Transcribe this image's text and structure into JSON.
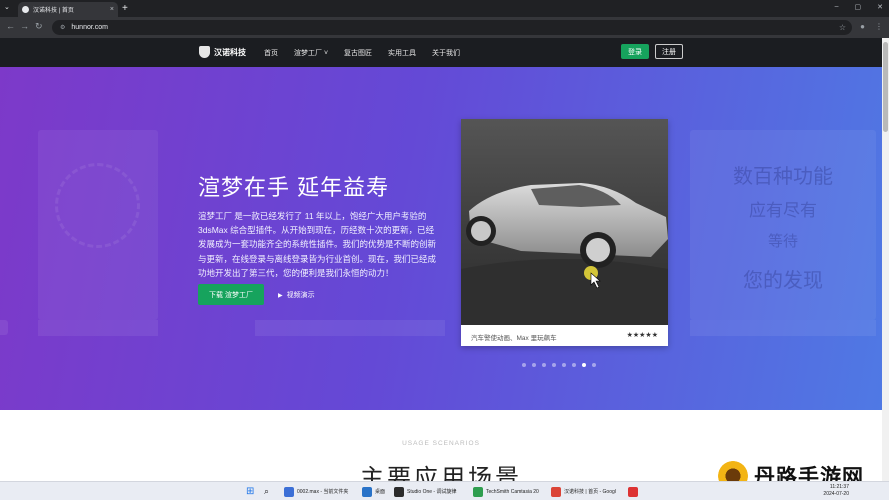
{
  "browser": {
    "tab_title": "汉诺科技 | 首页",
    "tab_close": "×",
    "new_tab": "+",
    "url": "hunnor.com"
  },
  "site": {
    "brand": "汉诺科技",
    "nav": [
      "首页",
      "渲梦工厂 ˅",
      "复古图匠",
      "实用工具",
      "关于我们"
    ],
    "login": "登录",
    "register": "注册"
  },
  "hero": {
    "title": "渲梦在手 延年益寿",
    "description": "渲梦工厂 是一款已经发行了 11 年以上，饱经广大用户考验的 3dsMax 综合型插件。从开始到现在，历经数十次的更新，已经发展成为一套功能齐全的系统性插件。我们的优势是不断的创新与更新，在线登录与离线登录皆为行业首创。现在，我们已经成功地开发出了第三代，您的便利是我们永恒的动力！",
    "download_btn": "下载 渲梦工厂",
    "video_btn": "视频演示",
    "ghost_right_lines": [
      "数百种功能",
      "应有尽有",
      "等待",
      "您的发现"
    ],
    "slide_caption": "汽车警使动画、Max 里玩飙车",
    "slide_stars": "★★★★★",
    "dots_total": 8,
    "dots_active": 7
  },
  "section": {
    "subtitle": "USAGE SCENARIOS",
    "title": "主要应用场景"
  },
  "watermark": {
    "text": "丹路手游网"
  },
  "taskbar": {
    "items": [
      {
        "label": "0002.max - 当前文件夹",
        "color": "#3c6fd6"
      },
      {
        "label": "桌面",
        "color": "#2a73c8"
      },
      {
        "label": "Studio One - 调试旋律",
        "color": "#2b2b2b"
      },
      {
        "label": "TechSmith Camtasia 20",
        "color": "#2f9e4f"
      },
      {
        "label": "汉诺科技 | 首页 - Googl",
        "color": "#db4437"
      },
      {
        "label": "",
        "color": "#d33"
      }
    ],
    "time": "11:21:37",
    "date": "2024-07-20"
  }
}
